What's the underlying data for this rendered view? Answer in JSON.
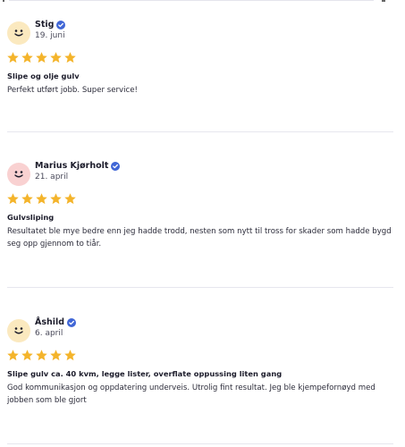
{
  "colors": {
    "star": "#f4b42b",
    "verified": "#4066d6",
    "avatar_yellow": "#fbe9bf",
    "avatar_pink": "#f9d1d1"
  },
  "reviews": [
    {
      "name": "Stig",
      "date": "19. juni",
      "rating": 5,
      "title": "Slipe og olje gulv",
      "body": "Perfekt utført jobb. Super service!"
    },
    {
      "name": "Marius Kjørholt",
      "date": "21. april",
      "rating": 5,
      "title": "Gulvsliping",
      "body": "Resultatet ble mye bedre enn jeg hadde trodd, nesten som nytt til tross for skader som hadde bygd seg opp gjennom to tiår."
    },
    {
      "name": "Åshild",
      "date": "6. april",
      "rating": 5,
      "title": "Slipe gulv ca. 40 kvm, legge lister, overflate oppussing liten gang",
      "body": "God kommunikasjon og oppdatering underveis. Utrolig fint resultat. Jeg ble kjempefornøyd med jobben som ble gjort"
    }
  ]
}
